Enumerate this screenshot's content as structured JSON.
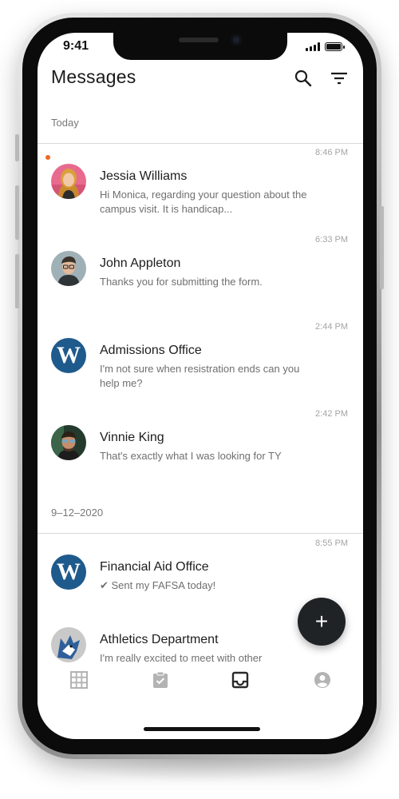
{
  "status_bar": {
    "time": "9:41"
  },
  "header": {
    "title": "Messages"
  },
  "sections": [
    {
      "label": "Today",
      "messages": [
        {
          "name": "Jessia Williams",
          "time": "8:46 PM",
          "preview": "Hi Monica, regarding your question about the campus visit. It is handicap...",
          "unread": true
        },
        {
          "name": "John Appleton",
          "time": "6:33 PM",
          "preview": "Thanks you for submitting the form.",
          "unread": false
        },
        {
          "name": "Admissions Office",
          "time": "2:44 PM",
          "preview": "I'm not sure when resistration ends can you help me?",
          "unread": false
        },
        {
          "name": "Vinnie King",
          "time": "2:42 PM",
          "preview": "That's exactly what I was looking for TY",
          "unread": false
        }
      ]
    },
    {
      "label": "9–12–2020",
      "messages": [
        {
          "name": "Financial Aid Office",
          "time": "8:55 PM",
          "preview": "✔ Sent my FAFSA today!",
          "unread": false
        },
        {
          "name": "Athletics Department",
          "time": "",
          "preview": "I'm really excited to meet with other",
          "unread": false
        }
      ]
    }
  ],
  "avatars": {
    "institution_letter": "W"
  },
  "fab": {
    "label": "+"
  },
  "bottom_nav": [
    "grid-icon",
    "assignment-icon",
    "inbox-icon",
    "account-icon"
  ],
  "colors": {
    "unread_dot": "#f26522",
    "brand_blue": "#1f5a8c",
    "fab": "#1f2326"
  }
}
